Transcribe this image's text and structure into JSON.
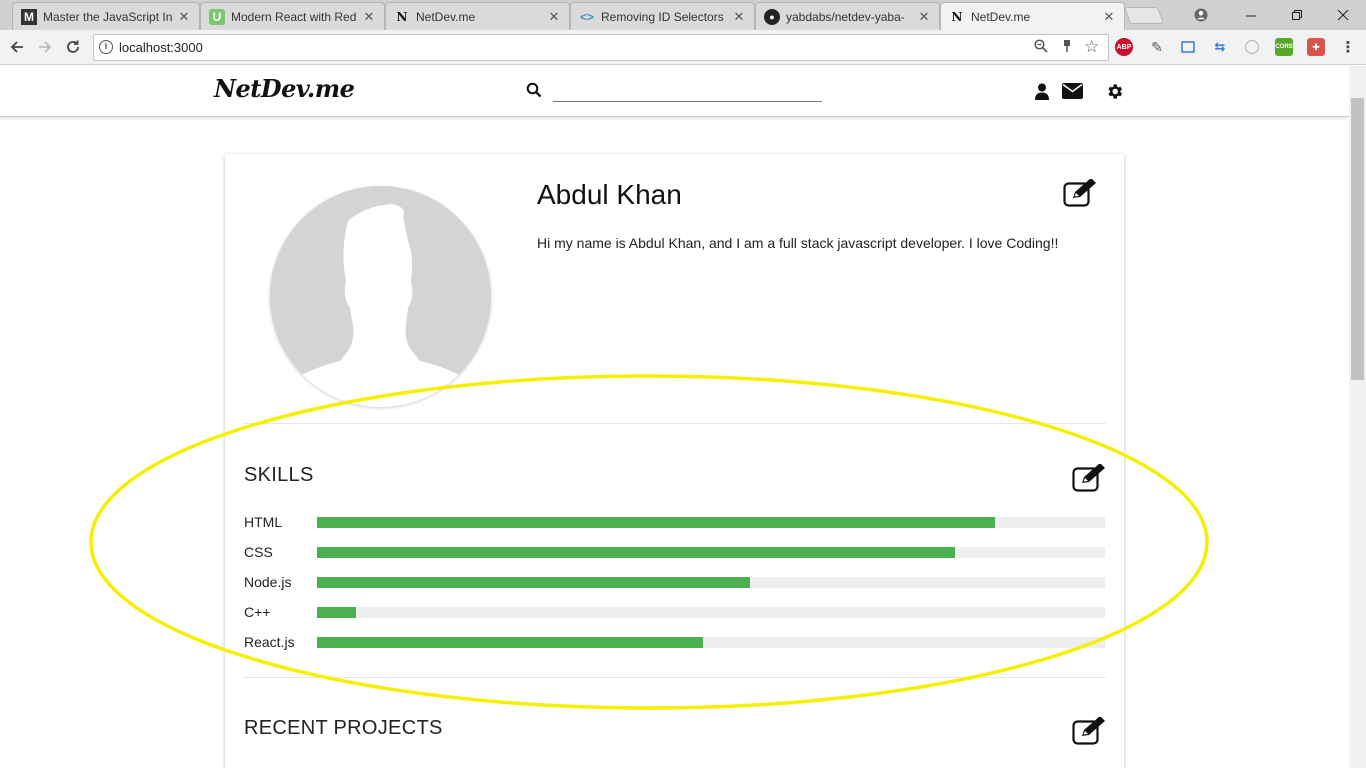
{
  "browser": {
    "tabs": [
      {
        "title": "Master the JavaScript In",
        "icon": "medium-icon",
        "active": false
      },
      {
        "title": "Modern React with Red",
        "icon": "udemy-icon",
        "active": false
      },
      {
        "title": "NetDev.me",
        "icon": "netdev-icon",
        "active": false
      },
      {
        "title": "Removing ID Selectors",
        "icon": "code-icon",
        "active": false
      },
      {
        "title": "yabdabs/netdev-yaba-",
        "icon": "github-icon",
        "active": false
      },
      {
        "title": "NetDev.me",
        "icon": "netdev-icon",
        "active": true
      }
    ],
    "url": "localhost:3000",
    "extensions": {
      "abp": "ABP",
      "cors": "CORS"
    }
  },
  "app": {
    "brand": "NetDev.me",
    "search_placeholder": ""
  },
  "profile": {
    "name": "Abdul Khan",
    "bio": "Hi my name is Abdul Khan, and I am a full stack javascript developer. I love Coding!!"
  },
  "skills": {
    "title": "SKILLS",
    "items": [
      {
        "name": "HTML",
        "level": 0.86
      },
      {
        "name": "CSS",
        "level": 0.81
      },
      {
        "name": "Node.js",
        "level": 0.55
      },
      {
        "name": "C++",
        "level": 0.05
      },
      {
        "name": "React.js",
        "level": 0.49
      }
    ]
  },
  "projects": {
    "title": "RECENT PROJECTS"
  },
  "colors": {
    "skill_bar": "#4caf50",
    "skill_track": "#eeeeee",
    "annotation": "#f5f000"
  }
}
